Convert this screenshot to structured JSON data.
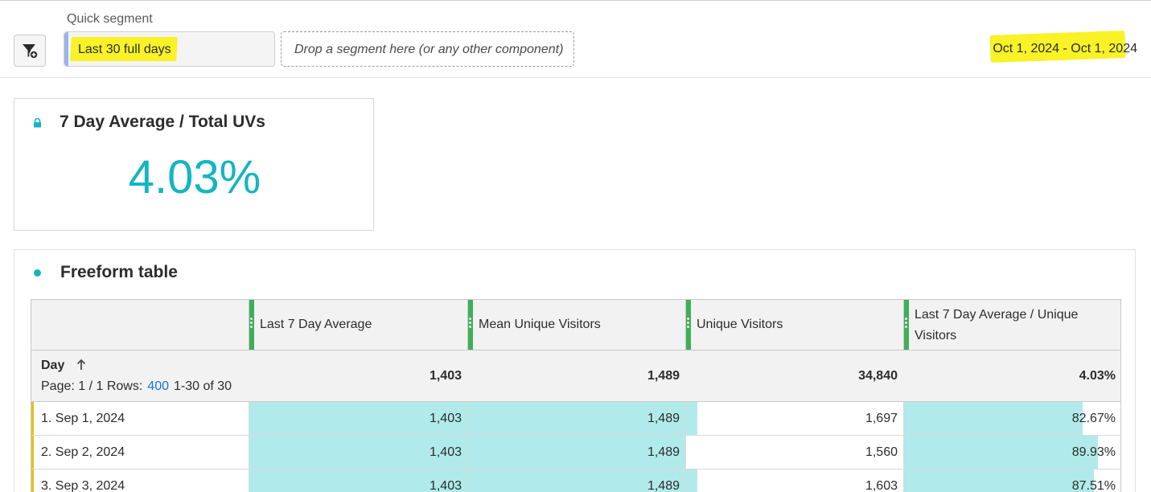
{
  "segment_bar": {
    "label": "Quick segment",
    "active_segment": "Last 30 full days",
    "drop_zone": "Drop a segment here (or any other component)",
    "date_range": "Oct 1, 2024 - Oct 1, 2024"
  },
  "summary": {
    "title": "7 Day Average / Total UVs",
    "value": "4.03%",
    "value_color": "#12b6c0"
  },
  "freeform": {
    "title": "Freeform table",
    "columns": [
      "Last 7 Day Average",
      "Mean Unique Visitors",
      "Unique Visitors",
      "Last 7 Day Average / Unique Visitors"
    ],
    "dimension": "Day",
    "page_label": "Page: 1 / 1",
    "rows_label": "Rows:",
    "rows_value": "400",
    "range_label": "1-30 of 30",
    "totals": [
      "1,403",
      "1,489",
      "34,840",
      "4.03%"
    ],
    "rows": [
      {
        "label": "1.  Sep 1, 2024",
        "values": [
          "1,403",
          "1,489",
          "1,697",
          "82.67%"
        ],
        "fills": [
          1.0,
          1.0,
          0.05,
          0.82
        ]
      },
      {
        "label": "2.  Sep 2, 2024",
        "values": [
          "1,403",
          "1,489",
          "1,560",
          "89.93%"
        ],
        "fills": [
          1.0,
          1.0,
          0.0,
          0.89
        ]
      },
      {
        "label": "3.  Sep 3, 2024",
        "values": [
          "1,403",
          "1,489",
          "1,603",
          "87.51%"
        ],
        "fills": [
          1.0,
          1.0,
          0.05,
          0.87
        ]
      }
    ],
    "bar_color": "#b1eaea",
    "header_accent": "#3fae5a",
    "row_accent": "#e3c01c",
    "link_color": "#1473e6"
  }
}
